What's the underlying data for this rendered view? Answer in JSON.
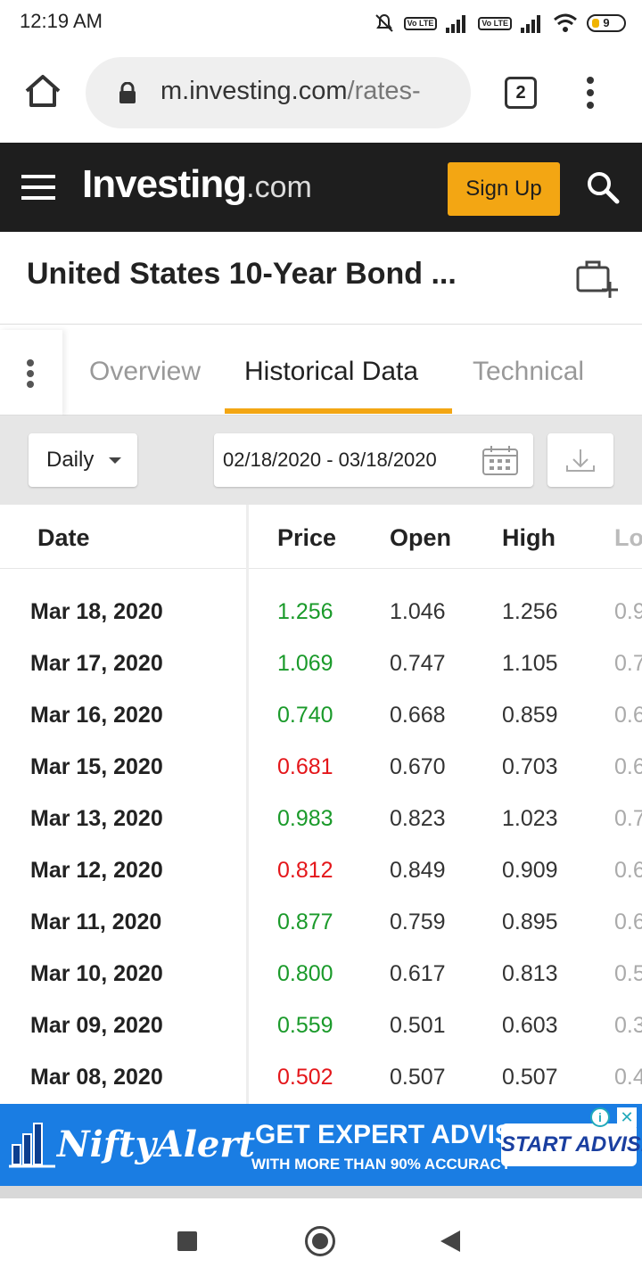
{
  "status_bar": {
    "time": "12:19 AM",
    "battery": "9",
    "sim1_badge": "Vo LTE",
    "sim2_badge": "Vo LTE"
  },
  "browser": {
    "url_host": "m.investing.com",
    "url_path": "/rates-",
    "tab_count": "2"
  },
  "site": {
    "logo_main": "Investing",
    "logo_suffix": ".com",
    "signup_label": "Sign Up"
  },
  "page": {
    "title": "United States 10-Year Bond ..."
  },
  "tabs": [
    {
      "label": "Overview",
      "active": false
    },
    {
      "label": "Historical Data",
      "active": true
    },
    {
      "label": "Technical",
      "active": false
    }
  ],
  "filters": {
    "period": "Daily",
    "date_range": "02/18/2020 - 03/18/2020"
  },
  "table": {
    "headers": [
      "Date",
      "Price",
      "Open",
      "High",
      "Lo"
    ],
    "rows": [
      {
        "date": "Mar 18, 2020",
        "price": "1.256",
        "open": "1.046",
        "high": "1.256",
        "low": "0.9",
        "dir": "up"
      },
      {
        "date": "Mar 17, 2020",
        "price": "1.069",
        "open": "0.747",
        "high": "1.105",
        "low": "0.7",
        "dir": "up"
      },
      {
        "date": "Mar 16, 2020",
        "price": "0.740",
        "open": "0.668",
        "high": "0.859",
        "low": "0.6",
        "dir": "up"
      },
      {
        "date": "Mar 15, 2020",
        "price": "0.681",
        "open": "0.670",
        "high": "0.703",
        "low": "0.6",
        "dir": "down"
      },
      {
        "date": "Mar 13, 2020",
        "price": "0.983",
        "open": "0.823",
        "high": "1.023",
        "low": "0.7",
        "dir": "up"
      },
      {
        "date": "Mar 12, 2020",
        "price": "0.812",
        "open": "0.849",
        "high": "0.909",
        "low": "0.6",
        "dir": "down"
      },
      {
        "date": "Mar 11, 2020",
        "price": "0.877",
        "open": "0.759",
        "high": "0.895",
        "low": "0.6",
        "dir": "up"
      },
      {
        "date": "Mar 10, 2020",
        "price": "0.800",
        "open": "0.617",
        "high": "0.813",
        "low": "0.5",
        "dir": "up"
      },
      {
        "date": "Mar 09, 2020",
        "price": "0.559",
        "open": "0.501",
        "high": "0.603",
        "low": "0.3",
        "dir": "up"
      },
      {
        "date": "Mar 08, 2020",
        "price": "0.502",
        "open": "0.507",
        "high": "0.507",
        "low": "0.4",
        "dir": "down"
      }
    ]
  },
  "ad": {
    "brand": "NiftyAlert",
    "headline": "GET EXPERT ADVISE",
    "subline": "WITH MORE THAN 90% ACCURACY",
    "cta": "START ADVISE"
  },
  "colors": {
    "accent": "#f3a613",
    "up": "#1a9a2a",
    "down": "#e4161a",
    "header_bg": "#1e1e1e",
    "ad_bg": "#1a7de3"
  },
  "icons": {
    "browser": [
      "home-icon",
      "lock-icon",
      "tabs-icon",
      "overflow-menu-icon"
    ],
    "site": [
      "hamburger-icon",
      "search-icon",
      "add-to-portfolio-icon"
    ],
    "filters": [
      "caret-down-icon",
      "calendar-icon",
      "download-icon"
    ],
    "nav": [
      "recents-icon",
      "home-circle-icon",
      "back-icon"
    ]
  }
}
